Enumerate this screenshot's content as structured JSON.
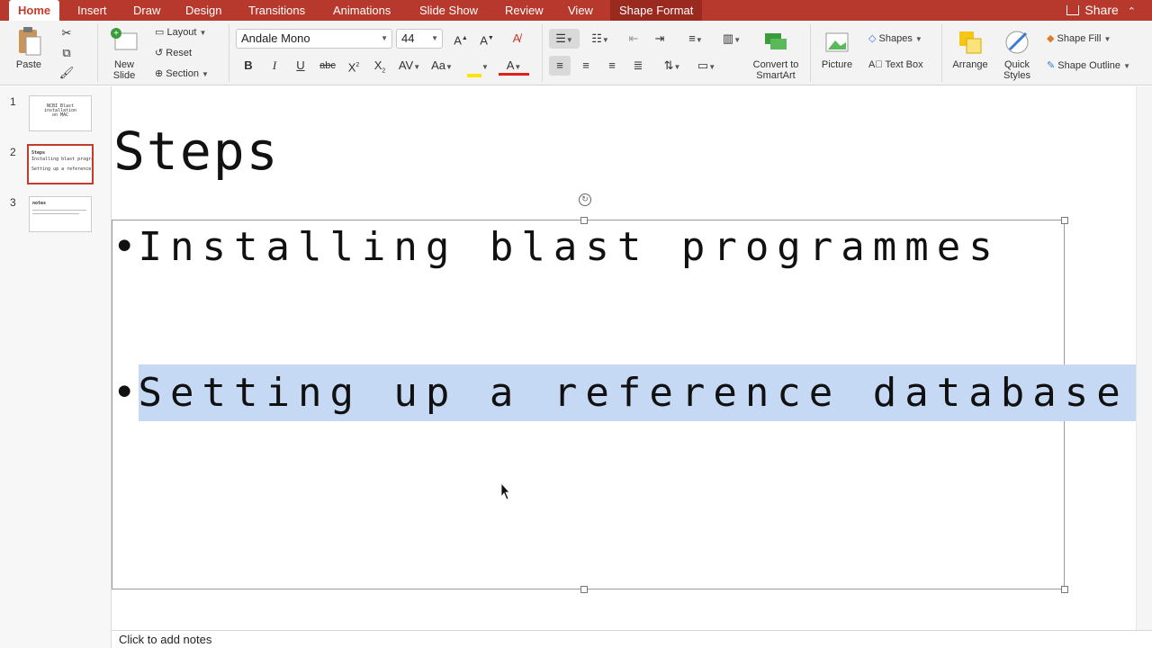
{
  "tabs": [
    "Home",
    "Insert",
    "Draw",
    "Design",
    "Transitions",
    "Animations",
    "Slide Show",
    "Review",
    "View",
    "Shape Format"
  ],
  "share_label": "Share",
  "ribbon": {
    "paste_label": "Paste",
    "new_slide_label": "New Slide",
    "layout_label": "Layout",
    "reset_label": "Reset",
    "section_label": "Section",
    "font_name": "Andale Mono",
    "font_size": "44",
    "convert_smartart_label": "Convert to SmartArt",
    "picture_label": "Picture",
    "shapes_label": "Shapes",
    "text_box_label": "Text Box",
    "arrange_label": "Arrange",
    "quick_styles_label": "Quick Styles",
    "shape_fill_label": "Shape Fill",
    "shape_outline_label": "Shape Outline",
    "highlight_color": "#ffe600",
    "font_color": "#e0211b"
  },
  "slides": [
    {
      "number": "1",
      "lines": [
        "NCBI Blast",
        "installation",
        "on MAC"
      ]
    },
    {
      "number": "2",
      "lines": [
        "Steps",
        "Installing blast programmes",
        "Setting up a reference database"
      ]
    },
    {
      "number": "3",
      "lines": [
        "notes"
      ]
    }
  ],
  "slide": {
    "title": "Steps",
    "bullet_char": "•",
    "bullets": [
      "Installing blast programmes",
      "Setting up a reference database"
    ]
  },
  "notes_placeholder": "Click to add notes",
  "colors": {
    "accent": "#b7382c",
    "selection": "#c5d9f5"
  }
}
